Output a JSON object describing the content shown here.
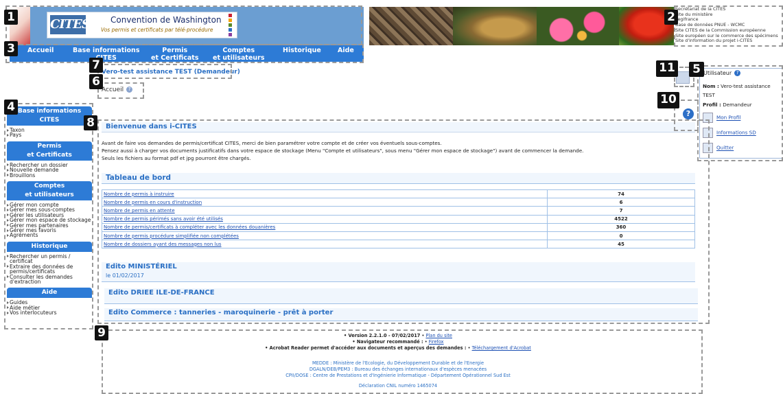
{
  "header": {
    "logo_text": "CITES",
    "title": "Convention de Washington",
    "subtitle": "Vos permis et certificats par télé-procédure",
    "external_links": [
      "Secrétariat de la CITES",
      "Site du ministère",
      "Legifrance",
      "Base de données PNUE - WCMC",
      "Site CITES de la Commission européenne",
      "Site européen sur le commerce des spécimens",
      "Site d'information du projet i-CITES"
    ]
  },
  "nav": {
    "items": [
      {
        "l1": "Accueil",
        "l2": ""
      },
      {
        "l1": "Base informations",
        "l2": "CITES"
      },
      {
        "l1": "Permis",
        "l2": "et Certificats"
      },
      {
        "l1": "Comptes",
        "l2": "et utilisateurs"
      },
      {
        "l1": "Historique",
        "l2": ""
      },
      {
        "l1": "Aide",
        "l2": ""
      }
    ]
  },
  "user_line": "Vero-test assistance TEST   (Demandeur)",
  "breadcrumb": "Accueil",
  "sidebar": {
    "sections": [
      {
        "title1": "Base informations",
        "title2": "CITES",
        "items": [
          "Taxon",
          "Pays"
        ]
      },
      {
        "title1": "Permis",
        "title2": "et Certificats",
        "items": [
          "Rechercher un dossier",
          "Nouvelle demande",
          "Brouillons"
        ]
      },
      {
        "title1": "Comptes",
        "title2": "et utilisateurs",
        "items": [
          "Gérer mon compte",
          "Gérer mes sous-comptes",
          "Gérer les utilisateurs",
          "Gérer mon espace de stockage",
          "Gérer mes partenaires",
          "Gérer mes favoris",
          "Agréments"
        ]
      },
      {
        "title1": "Historique",
        "title2": "",
        "items": [
          "Rechercher un permis / certificat",
          "Extraire des données de permis/certificats",
          "Consulter les demandes d'extraction"
        ]
      },
      {
        "title1": "Aide",
        "title2": "",
        "items": [
          "Guides",
          "Aide métier",
          "Vos interlocuteurs"
        ]
      }
    ]
  },
  "main": {
    "welcome_title": "Bienvenue dans i-CITES",
    "intro": [
      "Avant de faire vos demandes de permis/certificat CITES, merci de bien paramétrer votre compte et de créer vos éventuels sous-comptes.",
      "Pensez aussi à charger vos documents justificatifs dans votre espace de stockage (Menu \"Compte et utilisateurs\", sous menu \"Gérer mon espace de stockage\") avant de commencer la demande.",
      "Seuls les fichiers au format pdf et jpg pourront être chargés."
    ],
    "dashboard_title": "Tableau de bord",
    "dashboard_rows": [
      {
        "label": "Nombre de permis à instruire",
        "value": "74"
      },
      {
        "label": "Nombre de permis en cours d'instruction",
        "value": "6"
      },
      {
        "label": "Nombre de permis en attente",
        "value": "7"
      },
      {
        "label": "Nombre de permis périmés sans avoir été utilisés",
        "value": "4522"
      },
      {
        "label": "Nombre de permis/certificats à compléter avec les données douanières",
        "value": "360"
      },
      {
        "label": "Nombre de permis procédure simplifiée non complétées",
        "value": "0"
      },
      {
        "label": "Nombre de dossiers ayant des messages non lus",
        "value": "45"
      }
    ],
    "edito1_title": "Edito MINISTÉRIEL",
    "edito1_date": "le 01/02/2017",
    "edito2_title": "Edito DRIEE ILE-DE-FRANCE",
    "edito3_title": "Edito Commerce  : tanneries - maroquinerie - prêt à porter"
  },
  "user_panel": {
    "title": "Utilisateur",
    "name_label": "Nom :",
    "name_value": "Vero-test assistance TEST",
    "profile_label": "Profil :",
    "profile_value": "Demandeur",
    "links": [
      "Mon Profil",
      "Informations SD",
      "Quitter"
    ]
  },
  "footer": {
    "version_text": "• Version 2.2.1.0 - 07/02/2017",
    "plan_link": "Plan du site",
    "browser_text": "• Navigateur recommandé :",
    "browser_link": "Firefox",
    "acrobat_text": "• Acrobat Reader permet d'accéder aux documents et aperçus des demandes :",
    "acrobat_link": "Téléchargement d'Acrobat",
    "org_lines": [
      "MEDDE : Ministère de l'Ecologie, du Développement Durable et de l'Energie",
      "DGALN/DEB/PEM3 : Bureau des échanges internationaux d'espèces menacées",
      "CPII/DOSE : Centre de Prestations et d'Ingénierie Informatique - Département Opérationnel Sud Est"
    ],
    "cnil": "Déclaration CNIL numéro 1465074"
  },
  "annotations": [
    "1",
    "2",
    "3",
    "4",
    "5",
    "6",
    "7",
    "8",
    "9",
    "10",
    "11"
  ],
  "colors": {
    "nav_blue": "#2d7bd6",
    "header_blue": "#6b9ed2",
    "title_blue": "#2a6fc4"
  }
}
